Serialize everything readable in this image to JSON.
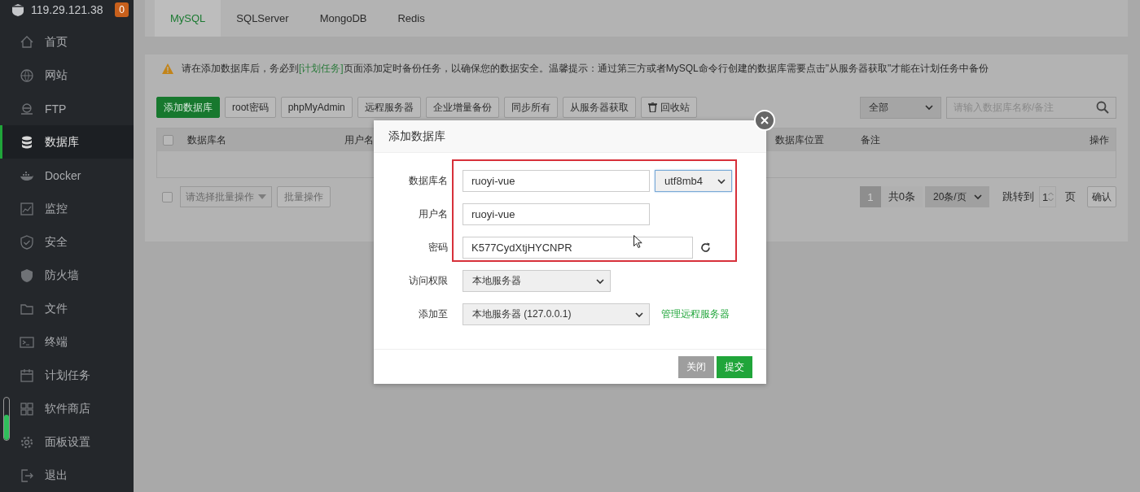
{
  "sidebar": {
    "server": "119.29.121.38",
    "badge": "0",
    "items": [
      {
        "label": "首页",
        "selected": false
      },
      {
        "label": "网站",
        "selected": false
      },
      {
        "label": "FTP",
        "selected": false
      },
      {
        "label": "数据库",
        "selected": true
      },
      {
        "label": "Docker",
        "selected": false
      },
      {
        "label": "监控",
        "selected": false
      },
      {
        "label": "安全",
        "selected": false
      },
      {
        "label": "防火墙",
        "selected": false
      },
      {
        "label": "文件",
        "selected": false
      },
      {
        "label": "终端",
        "selected": false
      },
      {
        "label": "计划任务",
        "selected": false
      },
      {
        "label": "软件商店",
        "selected": false
      },
      {
        "label": "面板设置",
        "selected": false
      },
      {
        "label": "退出",
        "selected": false
      }
    ],
    "meter": {
      "level": 0.6
    }
  },
  "tabs": [
    {
      "label": "MySQL",
      "selected": true
    },
    {
      "label": "SQLServer",
      "selected": false
    },
    {
      "label": "MongoDB",
      "selected": false
    },
    {
      "label": "Redis",
      "selected": false
    }
  ],
  "notice": {
    "before": "请在添加数据库后，务必到",
    "link": "[计划任务]",
    "after": "页面添加定时备份任务，以确保您的数据安全。温馨提示：通过第三方或者MySQL命令行创建的数据库需要点击\"从服务器获取\"才能在计划任务中备份"
  },
  "toolbar": [
    {
      "label": "添加数据库",
      "kind": "primary"
    },
    {
      "label": "root密码",
      "kind": "default"
    },
    {
      "label": "phpMyAdmin",
      "kind": "default"
    },
    {
      "label": "远程服务器",
      "kind": "default"
    },
    {
      "label": "企业增量备份",
      "kind": "default"
    },
    {
      "label": "同步所有",
      "kind": "default"
    },
    {
      "label": "从服务器获取",
      "kind": "default"
    },
    {
      "label": "回收站",
      "kind": "bin"
    }
  ],
  "filter": {
    "value": "全部"
  },
  "search": {
    "placeholder": "请输入数据库名称/备注"
  },
  "table": {
    "select_all": {
      "checked": false
    },
    "columns": [
      "数据库名",
      "用户名",
      "数据库位置",
      "备注",
      "操作"
    ]
  },
  "batch": {
    "checked": false,
    "select_placeholder": "请选择批量操作",
    "button": "批量操作"
  },
  "pagination": {
    "pages": [
      {
        "label": "1",
        "selected": true
      }
    ],
    "total": "共0条",
    "per_page": "20条/页",
    "jump_label": "跳转到",
    "page_value": "1",
    "page_unit": "页",
    "confirm": "确认"
  },
  "dialog": {
    "title": "添加数据库",
    "fields": [
      {
        "kind": "text-charset",
        "label": "数据库名",
        "value": "ruoyi-vue",
        "charset": "utf8mb4"
      },
      {
        "kind": "text",
        "label": "用户名",
        "value": "ruoyi-vue"
      },
      {
        "kind": "password",
        "label": "密码",
        "value": "K577CydXtjHYCNPR"
      },
      {
        "kind": "select",
        "label": "访问权限",
        "value": "本地服务器"
      },
      {
        "kind": "select-link",
        "label": "添加至",
        "value": "本地服务器 (127.0.0.1)",
        "link": "管理远程服务器"
      }
    ],
    "buttons": [
      {
        "label": "关闭",
        "kind": "secondary"
      },
      {
        "label": "提交",
        "kind": "primary"
      }
    ]
  }
}
